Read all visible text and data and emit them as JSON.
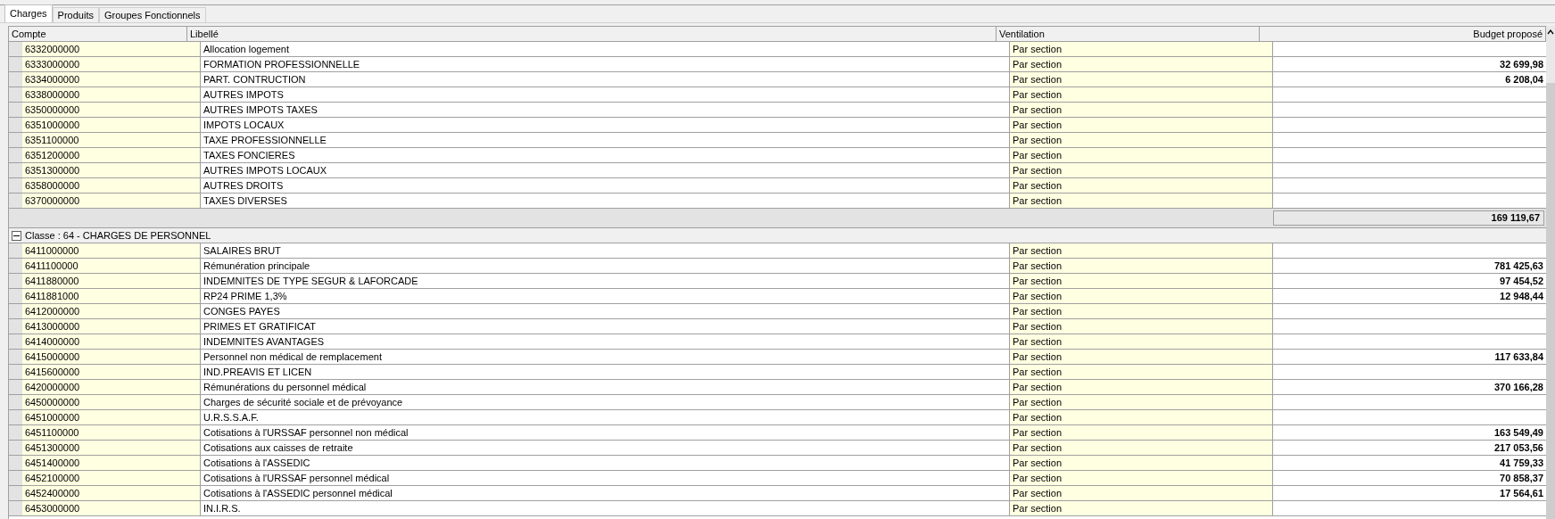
{
  "tabs": [
    {
      "label": "Charges",
      "selected": true
    },
    {
      "label": "Produits",
      "selected": false
    },
    {
      "label": "Groupes Fonctionnels",
      "selected": false
    }
  ],
  "table": {
    "columns": [
      "Compte",
      "Libellé",
      "Ventilation",
      "Budget proposé"
    ],
    "groups": [
      {
        "rows": [
          {
            "compte": "6332000000",
            "libelle": "Allocation logement",
            "ventilation": "Par section"
          },
          {
            "compte": "6333000000",
            "libelle": "FORMATION PROFESSIONNELLE",
            "ventilation": "Par section",
            "budget": "32 699,98"
          },
          {
            "compte": "6334000000",
            "libelle": "PART. CONTRUCTION",
            "ventilation": "Par section",
            "budget": "6 208,04"
          },
          {
            "compte": "6338000000",
            "libelle": "AUTRES IMPOTS",
            "ventilation": "Par section"
          },
          {
            "compte": "6350000000",
            "libelle": "AUTRES IMPOTS TAXES",
            "ventilation": "Par section"
          },
          {
            "compte": "6351000000",
            "libelle": "IMPOTS LOCAUX",
            "ventilation": "Par section"
          },
          {
            "compte": "6351100000",
            "libelle": "TAXE PROFESSIONNELLE",
            "ventilation": "Par section"
          },
          {
            "compte": "6351200000",
            "libelle": "TAXES FONCIERES",
            "ventilation": "Par section"
          },
          {
            "compte": "6351300000",
            "libelle": "AUTRES IMPOTS LOCAUX",
            "ventilation": "Par section"
          },
          {
            "compte": "6358000000",
            "libelle": "AUTRES DROITS",
            "ventilation": "Par section"
          },
          {
            "compte": "6370000000",
            "libelle": "TAXES DIVERSES",
            "ventilation": "Par section"
          }
        ],
        "subtotal": "169 119,67"
      },
      {
        "header": "Classe : 64 - CHARGES DE PERSONNEL",
        "expanded": true,
        "rows": [
          {
            "compte": "6411000000",
            "libelle": "SALAIRES BRUT",
            "ventilation": "Par section"
          },
          {
            "compte": "6411100000",
            "libelle": "Rémunération principale",
            "ventilation": "Par section",
            "budget": "781 425,63"
          },
          {
            "compte": "6411880000",
            "libelle": "INDEMNITES DE TYPE SEGUR & LAFORCADE",
            "ventilation": "Par section",
            "budget": "97 454,52"
          },
          {
            "compte": "6411881000",
            "libelle": "RP24 PRIME 1,3%",
            "ventilation": "Par section",
            "budget": "12 948,44"
          },
          {
            "compte": "6412000000",
            "libelle": "CONGES PAYES",
            "ventilation": "Par section"
          },
          {
            "compte": "6413000000",
            "libelle": "PRIMES ET GRATIFICAT",
            "ventilation": "Par section"
          },
          {
            "compte": "6414000000",
            "libelle": "INDEMNITES AVANTAGES",
            "ventilation": "Par section"
          },
          {
            "compte": "6415000000",
            "libelle": "Personnel non médical de remplacement",
            "ventilation": "Par section",
            "budget": "117 633,84"
          },
          {
            "compte": "6415600000",
            "libelle": "IND.PREAVIS ET LICEN",
            "ventilation": "Par section"
          },
          {
            "compte": "6420000000",
            "libelle": "Rémunérations du personnel médical",
            "ventilation": "Par section",
            "budget": "370 166,28"
          },
          {
            "compte": "6450000000",
            "libelle": "Charges de sécurité sociale et de prévoyance",
            "ventilation": "Par section"
          },
          {
            "compte": "6451000000",
            "libelle": "U.R.S.S.A.F.",
            "ventilation": "Par section"
          },
          {
            "compte": "6451100000",
            "libelle": "Cotisations à l'URSSAF personnel non médical",
            "ventilation": "Par section",
            "budget": "163 549,49"
          },
          {
            "compte": "6451300000",
            "libelle": "Cotisations aux caisses de retraite",
            "ventilation": "Par section",
            "budget": "217 053,56"
          },
          {
            "compte": "6451400000",
            "libelle": "Cotisations à l'ASSEDIC",
            "ventilation": "Par section",
            "budget": "41 759,33"
          },
          {
            "compte": "6452100000",
            "libelle": "Cotisations à l'URSSAF personnel médical",
            "ventilation": "Par section",
            "budget": "70 858,37"
          },
          {
            "compte": "6452400000",
            "libelle": "Cotisations à l'ASSEDIC personnel médical",
            "ventilation": "Par section",
            "budget": "17 564,61"
          },
          {
            "compte": "6453000000",
            "libelle": "IN.I.R.S.",
            "ventilation": "Par section"
          }
        ]
      }
    ]
  }
}
